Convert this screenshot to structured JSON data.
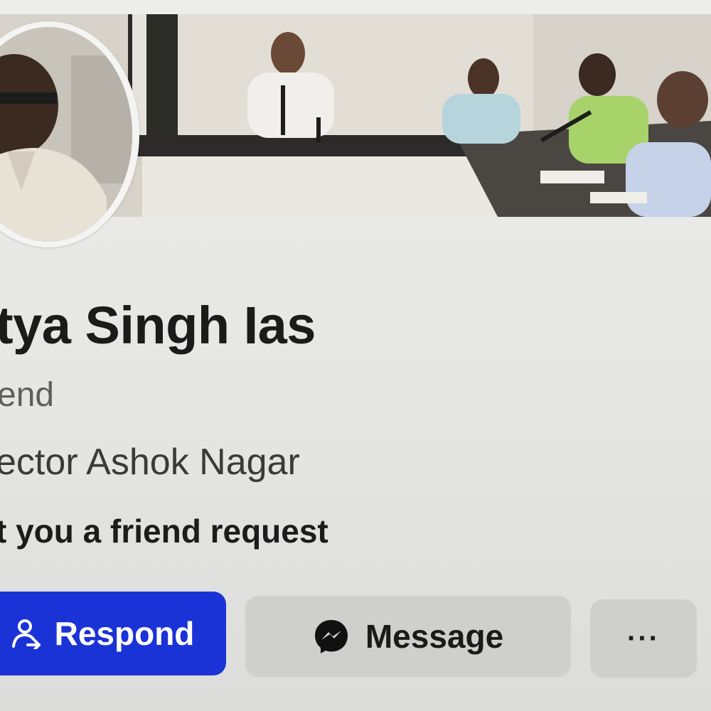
{
  "profile": {
    "name": "tya Singh Ias",
    "relation": "end",
    "job": "ector Ashok Nagar",
    "request_text": "t you a friend request"
  },
  "actions": {
    "respond_label": "Respond",
    "message_label": "Message",
    "more_label": "···"
  },
  "icons": {
    "respond": "person-arrow-icon",
    "message": "messenger-icon",
    "more": "more-dots-icon"
  },
  "colors": {
    "respond_bg": "#1a33d6",
    "secondary_bg": "#cfcfcd",
    "page_bg": "#e9e9e7"
  }
}
